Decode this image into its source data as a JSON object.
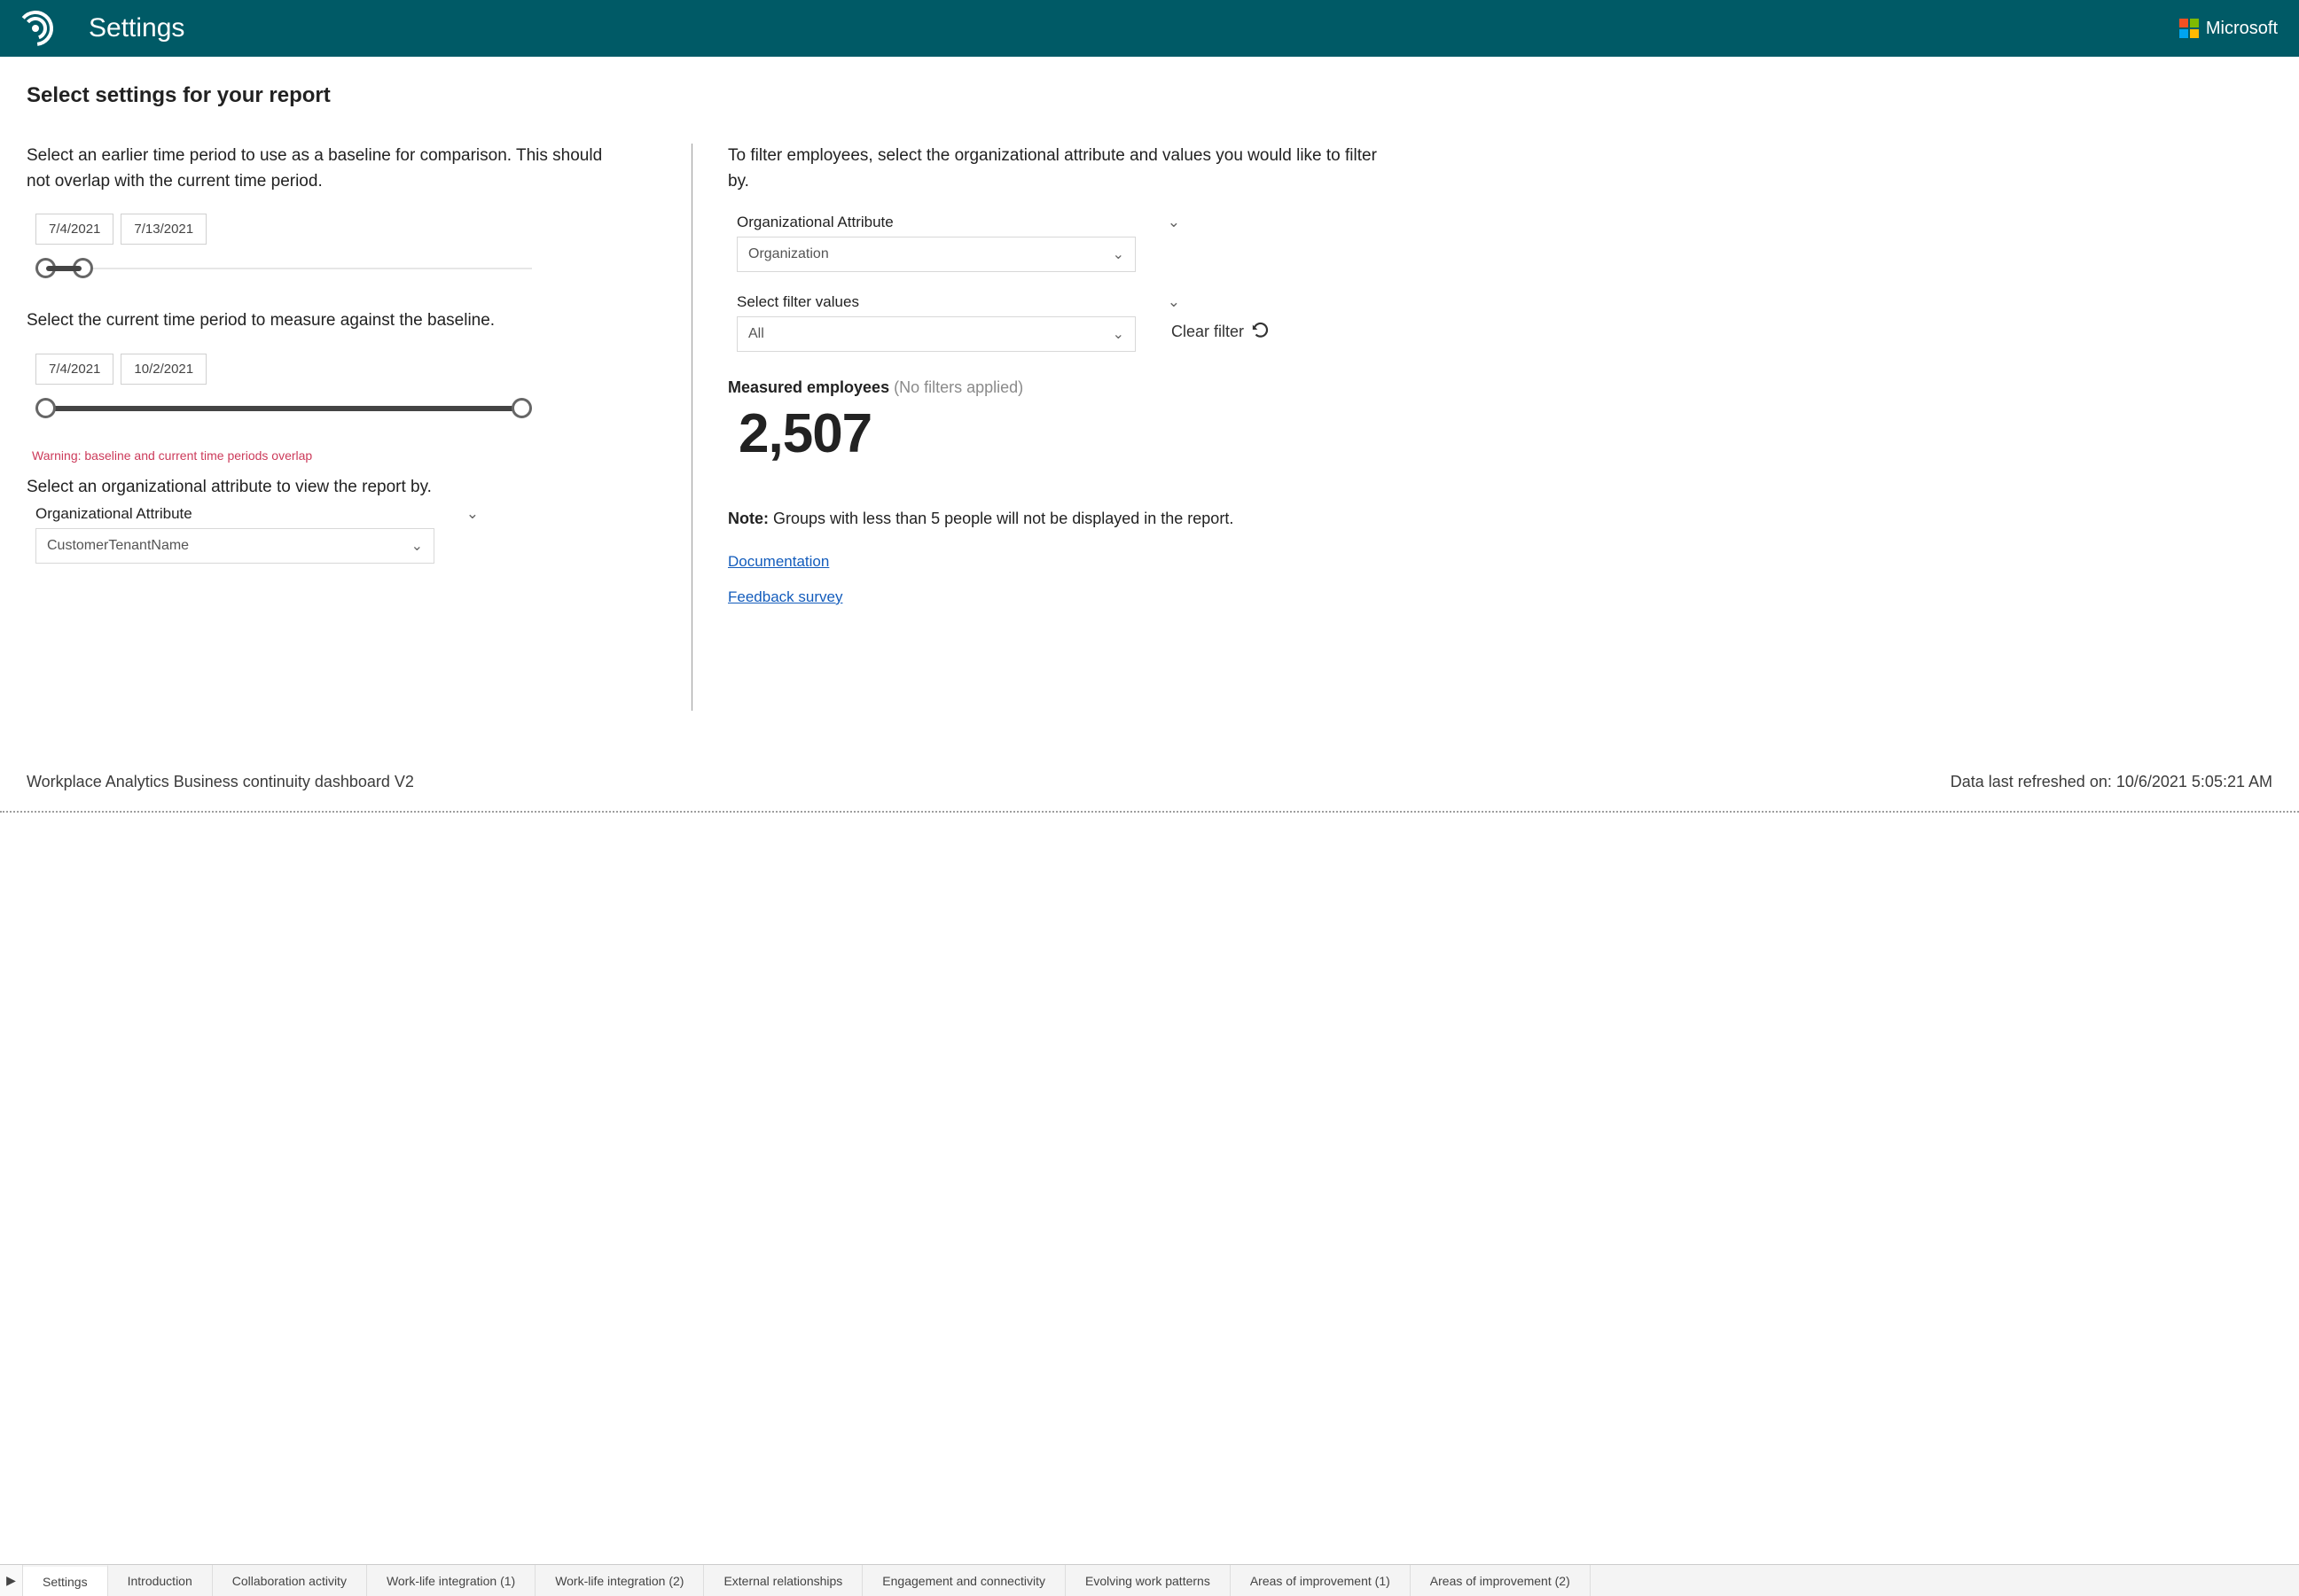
{
  "header": {
    "title": "Settings",
    "brand": "Microsoft"
  },
  "page": {
    "heading": "Select settings for your report"
  },
  "left": {
    "baseline_instruction": "Select an earlier time period to use as a baseline for comparison. This should not overlap with the current time period.",
    "baseline_start": "7/4/2021",
    "baseline_end": "7/13/2021",
    "current_instruction": "Select the current time period to measure against the baseline.",
    "current_start": "7/4/2021",
    "current_end": "10/2/2021",
    "warning": "Warning: baseline and current time periods overlap",
    "org_attr_instruction": "Select an organizational attribute to view the report by.",
    "org_attr_label": "Organizational Attribute",
    "org_attr_value": "CustomerTenantName"
  },
  "right": {
    "filter_instruction": "To filter employees, select the organizational attribute and values you would like to filter by.",
    "org_attr_label": "Organizational Attribute",
    "org_attr_value": "Organization",
    "filter_values_label": "Select filter values",
    "filter_values_value": "All",
    "clear_filter_label": "Clear filter",
    "measured_label": "Measured employees",
    "measured_note": "(No filters applied)",
    "measured_value": "2,507",
    "note_label": "Note:",
    "note_text": "Groups with less than 5 people will not be displayed in the report.",
    "doc_link": "Documentation",
    "survey_link": "Feedback survey"
  },
  "footer": {
    "product": "Workplace Analytics Business continuity dashboard V2",
    "refreshed_label": "Data last refreshed on: ",
    "refreshed_value": "10/6/2021 5:05:21 AM"
  },
  "tabs": {
    "items": [
      "Settings",
      "Introduction",
      "Collaboration activity",
      "Work-life integration (1)",
      "Work-life integration (2)",
      "External relationships",
      "Engagement and connectivity",
      "Evolving work patterns",
      "Areas of improvement (1)",
      "Areas of improvement (2)"
    ],
    "active_index": 0
  }
}
